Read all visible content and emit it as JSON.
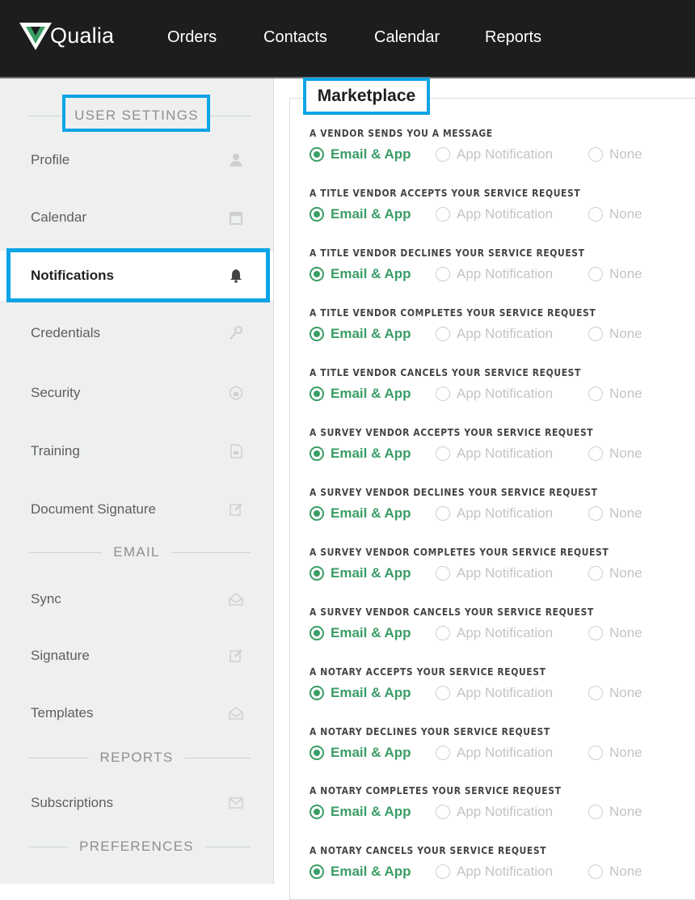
{
  "app": {
    "brand": "Qualia",
    "accent": "#3b9d66",
    "highlight": "#0ba4e6"
  },
  "topnav": {
    "items": [
      "Orders",
      "Contacts",
      "Calendar",
      "Reports"
    ]
  },
  "sidebar": {
    "sections": {
      "user_settings": "USER SETTINGS",
      "email": "EMAIL",
      "reports": "REPORTS",
      "preferences": "PREFERENCES"
    },
    "items": [
      {
        "label": "Profile",
        "icon": "user-icon"
      },
      {
        "label": "Calendar",
        "icon": "calendar-icon"
      },
      {
        "label": "Notifications",
        "icon": "bell-icon",
        "active": true
      },
      {
        "label": "Credentials",
        "icon": "key-icon"
      },
      {
        "label": "Security",
        "icon": "lock-circle-icon"
      },
      {
        "label": "Training",
        "icon": "video-file-icon"
      },
      {
        "label": "Document Signature",
        "icon": "edit-icon"
      },
      {
        "label": "Sync",
        "icon": "envelope-open-icon"
      },
      {
        "label": "Signature",
        "icon": "edit-icon"
      },
      {
        "label": "Templates",
        "icon": "envelope-open-icon"
      },
      {
        "label": "Subscriptions",
        "icon": "envelope-icon"
      }
    ]
  },
  "main": {
    "section_title": "Marketplace",
    "options": [
      "Email & App",
      "App Notification",
      "None"
    ],
    "settings": [
      {
        "title": "A VENDOR SENDS YOU A MESSAGE",
        "selected": "Email & App"
      },
      {
        "title": "A TITLE VENDOR ACCEPTS YOUR SERVICE REQUEST",
        "selected": "Email & App"
      },
      {
        "title": "A TITLE VENDOR DECLINES YOUR SERVICE REQUEST",
        "selected": "Email & App"
      },
      {
        "title": "A TITLE VENDOR COMPLETES YOUR SERVICE REQUEST",
        "selected": "Email & App"
      },
      {
        "title": "A TITLE VENDOR CANCELS YOUR SERVICE REQUEST",
        "selected": "Email & App"
      },
      {
        "title": "A SURVEY VENDOR ACCEPTS YOUR SERVICE REQUEST",
        "selected": "Email & App"
      },
      {
        "title": "A SURVEY VENDOR DECLINES YOUR SERVICE REQUEST",
        "selected": "Email & App"
      },
      {
        "title": "A SURVEY VENDOR COMPLETES YOUR SERVICE REQUEST",
        "selected": "Email & App"
      },
      {
        "title": "A SURVEY VENDOR CANCELS YOUR SERVICE REQUEST",
        "selected": "Email & App"
      },
      {
        "title": "A NOTARY ACCEPTS YOUR SERVICE REQUEST",
        "selected": "Email & App"
      },
      {
        "title": "A NOTARY DECLINES YOUR SERVICE REQUEST",
        "selected": "Email & App"
      },
      {
        "title": "A NOTARY COMPLETES YOUR SERVICE REQUEST",
        "selected": "Email & App"
      },
      {
        "title": "A NOTARY CANCELS YOUR SERVICE REQUEST",
        "selected": "Email & App"
      }
    ]
  }
}
